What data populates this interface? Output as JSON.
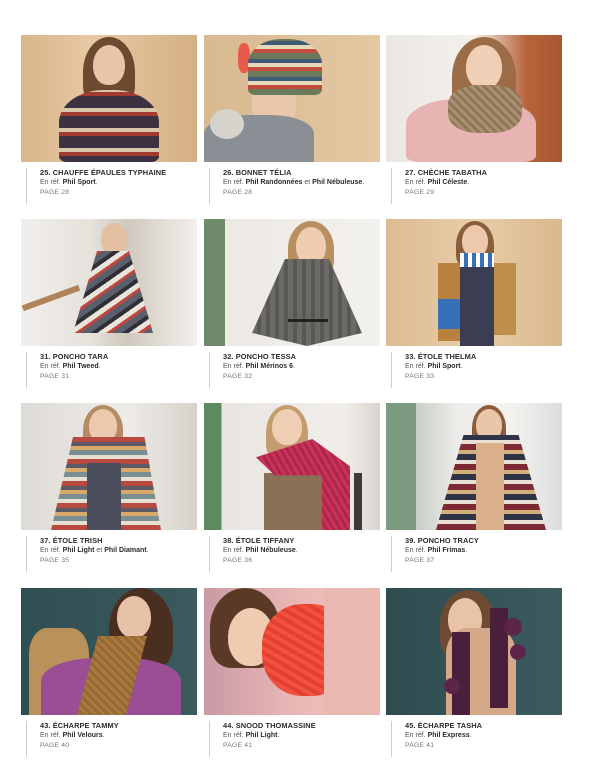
{
  "items": [
    {
      "title": "25. CHAUFFE ÉPAULES TYPHAINE",
      "ref_prefix": "En réf.",
      "yarn1": "Phil Sport",
      "connector": "",
      "yarn2": "",
      "page": "PAGE 28"
    },
    {
      "title": "26. BONNET TÉLIA",
      "ref_prefix": "En réf.",
      "yarn1": "Phil Randonnées",
      "connector": "et",
      "yarn2": "Phil Nébuleuse",
      "page": "PAGE 28"
    },
    {
      "title": "27. CHÈCHE TABATHA",
      "ref_prefix": "En réf.",
      "yarn1": "Phil Céleste",
      "connector": "",
      "yarn2": "",
      "page": "PAGE 29"
    },
    {
      "title": "31. PONCHO TARA",
      "ref_prefix": "En réf.",
      "yarn1": "Phil Tweed",
      "connector": "",
      "yarn2": "",
      "page": "PAGE 31"
    },
    {
      "title": "32. PONCHO TESSA",
      "ref_prefix": "En réf.",
      "yarn1": "Phil Mérinos 6",
      "connector": "",
      "yarn2": "",
      "page": "PAGE 32"
    },
    {
      "title": "33. ÉTOLE THELMA",
      "ref_prefix": "En réf.",
      "yarn1": "Phil Sport",
      "connector": "",
      "yarn2": "",
      "page": "PAGE 33"
    },
    {
      "title": "37. ÉTOLE TRISH",
      "ref_prefix": "En réf.",
      "yarn1": "Phil Light",
      "connector": "et",
      "yarn2": "Phil Diamant",
      "page": "PAGE 35"
    },
    {
      "title": "38. ÉTOLE TIFFANY",
      "ref_prefix": "En réf.",
      "yarn1": "Phil Nébuleuse",
      "connector": "",
      "yarn2": "",
      "page": "PAGE 36"
    },
    {
      "title": "39. PONCHO TRACY",
      "ref_prefix": "En réf.",
      "yarn1": "Phil Frimas",
      "connector": "",
      "yarn2": "",
      "page": "PAGE 37"
    },
    {
      "title": "43. ÉCHARPE TAMMY",
      "ref_prefix": "En réf.",
      "yarn1": "Phil Velours",
      "connector": "",
      "yarn2": "",
      "page": "PAGE 40"
    },
    {
      "title": "44. SNOOD THOMASSINE",
      "ref_prefix": "En réf.",
      "yarn1": "Phil Light",
      "connector": "",
      "yarn2": "",
      "page": "PAGE 41"
    },
    {
      "title": "45. ÉCHARPE TASHA",
      "ref_prefix": "En réf.",
      "yarn1": "Phil Express",
      "connector": "",
      "yarn2": "",
      "page": "PAGE 41"
    }
  ]
}
